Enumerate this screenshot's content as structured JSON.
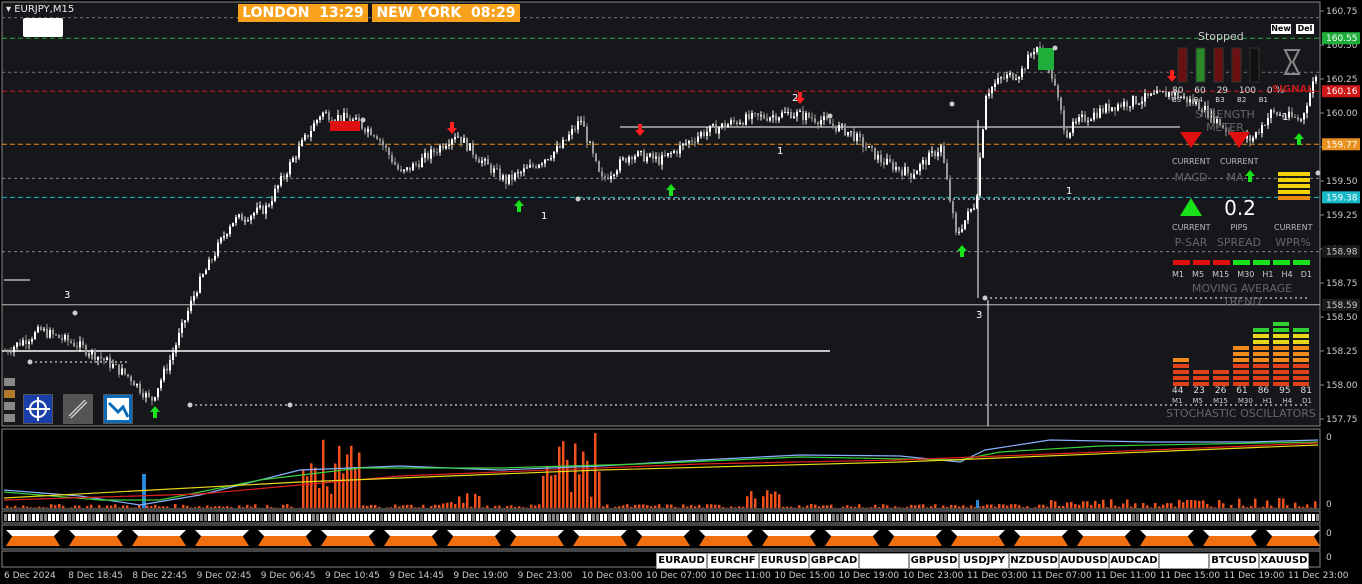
{
  "symbol": "EURJPY,M15",
  "sessions": [
    {
      "city": "LONDON",
      "time": "13:29"
    },
    {
      "city": "NEW YORK",
      "time": "08:29"
    }
  ],
  "status": "Stopped",
  "buttons": {
    "new": "New",
    "del": "Del"
  },
  "price_axis": {
    "ticks": [
      "160.75",
      "160.50",
      "160.25",
      "160.00",
      "159.75",
      "159.50",
      "159.25",
      "159.00",
      "158.75",
      "158.50",
      "158.25",
      "158.00",
      "157.75"
    ],
    "highlights": [
      {
        "value": "160.55",
        "color": "#1fae3a"
      },
      {
        "value": "160.16",
        "color": "#d01818"
      },
      {
        "value": "159.77",
        "color": "#e8911e"
      },
      {
        "value": "159.38",
        "color": "#17b8c8"
      },
      {
        "value": "158.98",
        "color": "#1b1b1b"
      },
      {
        "value": "158.59",
        "color": "#1b1b1b"
      }
    ]
  },
  "sub_axis": {
    "top": "0",
    "bottom": "0"
  },
  "sub2_axis": [
    "0",
    "0"
  ],
  "time_axis": [
    "6 Dec 2024",
    "8 Dec 18:45",
    "8 Dec 22:45",
    "9 Dec 02:45",
    "9 Dec 06:45",
    "9 Dec 10:45",
    "9 Dec 14:45",
    "9 Dec 19:00",
    "9 Dec 23:00",
    "10 Dec 03:00",
    "10 Dec 07:00",
    "10 Dec 11:00",
    "10 Dec 15:00",
    "10 Dec 19:00",
    "10 Dec 23:00",
    "11 Dec 03:00",
    "11 Dec 07:00",
    "11 Dec 11:00",
    "11 Dec 15:00",
    "11 Dec 19:00",
    "11 Dec 23:00"
  ],
  "chart_labels": [
    "3",
    "2",
    "1",
    "1",
    "1",
    "3",
    "1"
  ],
  "strength_meter": {
    "values": [
      "80",
      "60",
      "29",
      "100",
      "0 %"
    ],
    "labels": [
      "BS",
      "B4",
      "B3",
      "B2",
      "B1"
    ],
    "title": "STRENGTH METER",
    "signal": "SIGNAL"
  },
  "panels": {
    "current": "CURRENT",
    "macd": "MACD",
    "ma": "MA",
    "psar": "P-SAR",
    "pips_label": "PIPS",
    "pips_value": "0.2",
    "spread": "SPREAD",
    "wpr": "WPR%",
    "ma_trend": "MOVING AVERAGE TREND",
    "timeframes": [
      "M1",
      "M5",
      "M15",
      "M30",
      "H1",
      "H4",
      "D1"
    ],
    "stoch_title": "STOCHASTIC OSCILLATORS",
    "stoch_values": [
      "44",
      "23",
      "26",
      "61",
      "86",
      "95",
      "81"
    ]
  },
  "pairs": [
    "EURAUD",
    "EURCHF",
    "EURUSD",
    "GBPCAD",
    "",
    "GBPUSD",
    "USDJPY",
    "NZDUSD",
    "AUDUSD",
    "AUDCAD",
    "",
    "BTCUSD",
    "XAUUSD"
  ],
  "colors": {
    "bull": "#ffffff",
    "bear": "#9a9a9a",
    "up_arrow": "#19e21a",
    "down_arrow": "#ff2020",
    "session": "#f7a21a"
  }
}
